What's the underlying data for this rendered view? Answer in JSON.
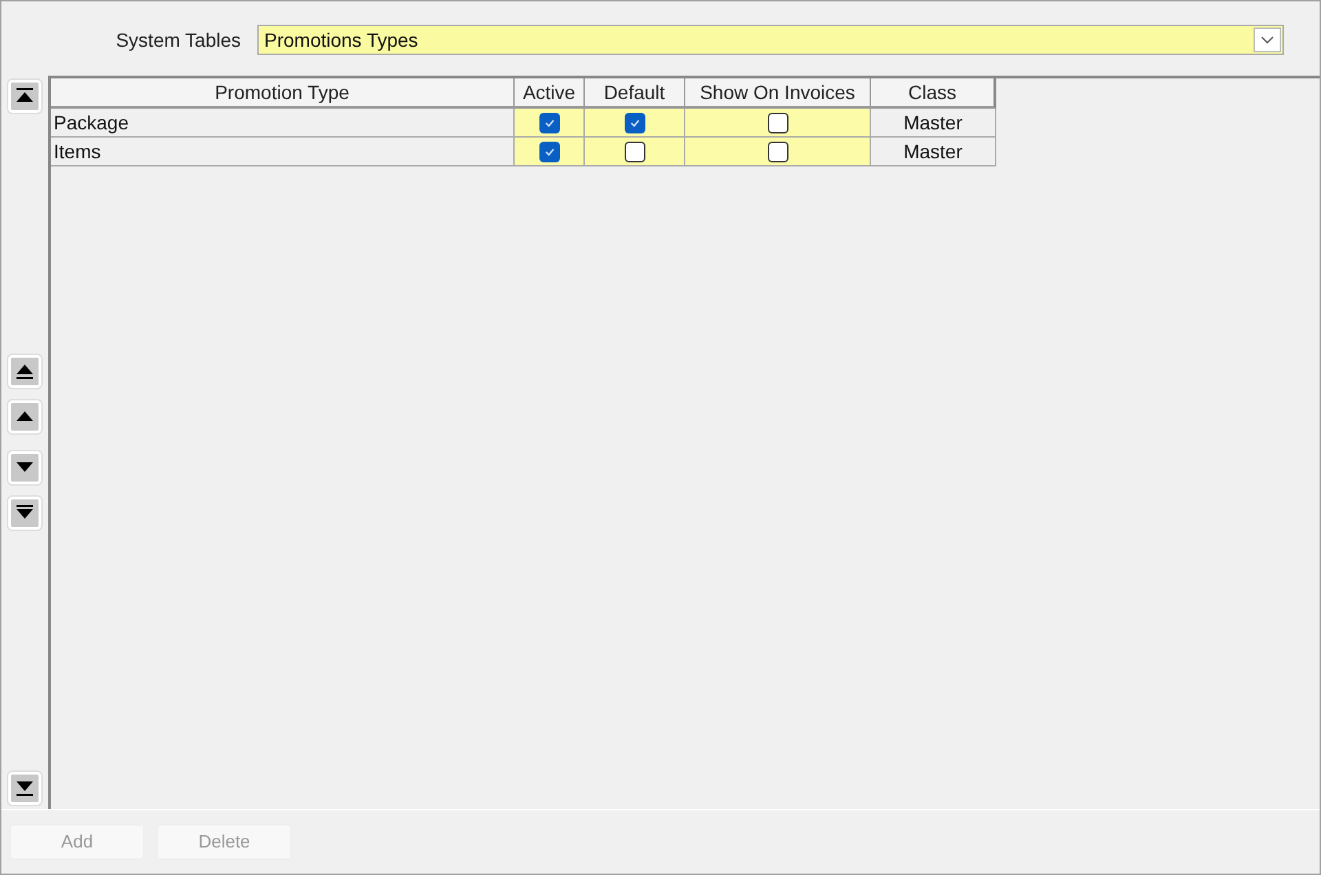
{
  "selector": {
    "label": "System Tables",
    "value": "Promotions Types"
  },
  "table": {
    "columns": [
      {
        "label": "Promotion Type",
        "kind": "text"
      },
      {
        "label": "Active",
        "kind": "check"
      },
      {
        "label": "Default",
        "kind": "check"
      },
      {
        "label": "Show On Invoices",
        "kind": "check"
      },
      {
        "label": "Class",
        "kind": "class"
      }
    ],
    "rows": [
      {
        "promotion_type": "Package",
        "active": true,
        "default": true,
        "show_on_invoices": false,
        "class": "Master"
      },
      {
        "promotion_type": "Items",
        "active": true,
        "default": false,
        "show_on_invoices": false,
        "class": "Master"
      }
    ]
  },
  "nav_buttons": [
    {
      "kind": "first"
    },
    {
      "kind": "page_up"
    },
    {
      "kind": "up"
    },
    {
      "kind": "down"
    },
    {
      "kind": "page_down"
    },
    {
      "kind": "last"
    }
  ],
  "buttons": [
    {
      "label": "Add",
      "disabled": true
    },
    {
      "label": "Delete",
      "disabled": true
    }
  ]
}
